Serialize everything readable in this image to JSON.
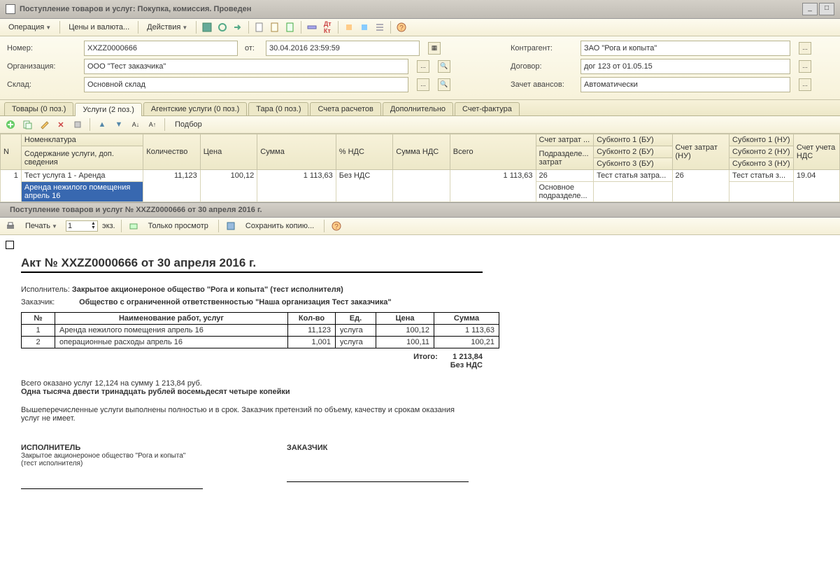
{
  "window": {
    "title": "Поступление товаров и услуг: Покупка, комиссия. Проведен"
  },
  "toolbar": {
    "operation": "Операция",
    "prices": "Цены и валюта...",
    "actions": "Действия"
  },
  "form": {
    "number_label": "Номер:",
    "number_value": "XXZZ0000666",
    "from_label": "от:",
    "date_value": "30.04.2016 23:59:59",
    "org_label": "Организация:",
    "org_value": "ООО \"Тест заказчика\"",
    "storage_label": "Склад:",
    "storage_value": "Основной склад",
    "counterparty_label": "Контрагент:",
    "counterparty_value": "ЗАО \"Рога и копыта\"",
    "contract_label": "Договор:",
    "contract_value": "дог 123 от 01.05.15",
    "advance_label": "Зачет авансов:",
    "advance_value": "Автоматически"
  },
  "tabs": {
    "goods": "Товары (0 поз.)",
    "services": "Услуги (2 поз.)",
    "agent": "Агентские услуги (0 поз.)",
    "tara": "Тара (0 поз.)",
    "accounts": "Счета расчетов",
    "extra": "Дополнительно",
    "invoice": "Счет-фактура"
  },
  "subtoolbar": {
    "selection": "Подбор"
  },
  "grid": {
    "headers": {
      "n": "N",
      "nomen": "Номенклатура",
      "nomen2": "Содержание услуги, доп. сведения",
      "qty": "Количество",
      "price": "Цена",
      "sum": "Сумма",
      "vat_pct": "% НДС",
      "vat_sum": "Сумма НДС",
      "total": "Всего",
      "cost_acc": "Счет затрат ...",
      "cost_acc2": "Подразделе... затрат",
      "sub1": "Субконто 1 (БУ)",
      "sub2": "Субконто 2 (БУ)",
      "sub3": "Субконто 3 (БУ)",
      "cost_nu": "Счет затрат (НУ)",
      "sub1nu": "Субконто 1 (НУ)",
      "sub2nu": "Субконто 2 (НУ)",
      "sub3nu": "Субконто 3 (НУ)",
      "vat_acc": "Счет учета НДС"
    },
    "row": {
      "n": "1",
      "nomen": "Тест услуга 1 - Аренда",
      "desc": "Аренда нежилого помещения апрель 16",
      "qty": "11,123",
      "price": "100,12",
      "sum": "1 113,63",
      "vat": "Без НДС",
      "total": "1 113,63",
      "acc": "26",
      "acc2": "Основное подразделе...",
      "sub1": "Тест статья затра...",
      "nu": "26",
      "sub1nu": "Тест статья з...",
      "vat_acc": "19.04"
    }
  },
  "print": {
    "title": "Поступление товаров и услуг № XXZZ0000666 от 30 апреля 2016 г.",
    "print_btn": "Печать",
    "copies": "1",
    "copies_label": "экз.",
    "view_only": "Только просмотр",
    "save_copy": "Сохранить копию...",
    "doc_title": "Акт № XXZZ0000666 от 30 апреля 2016 г.",
    "performer_label": "Исполнитель:",
    "performer": "Закрытое акционероное общество \"Рога и копыта\" (тест исполнителя)",
    "customer_label": "Заказчик:",
    "customer": "Общество с ограниченной ответственностью \"Наша организация Тест заказчика\"",
    "th_n": "№",
    "th_name": "Наименование работ, услуг",
    "th_qty": "Кол-во",
    "th_unit": "Ед.",
    "th_price": "Цена",
    "th_sum": "Сумма",
    "r1": {
      "n": "1",
      "name": "Аренда нежилого помещения апрель 16",
      "qty": "11,123",
      "unit": "услуга",
      "price": "100,12",
      "sum": "1 113,63"
    },
    "r2": {
      "n": "2",
      "name": "операционные расходы  апрель 16",
      "qty": "1,001",
      "unit": "услуга",
      "price": "100,11",
      "sum": "100,21"
    },
    "total_label": "Итого:",
    "total": "1 213,84",
    "no_vat": "Без НДС",
    "summary": "Всего оказано услуг 12,124 на сумму 1 213,84 руб.",
    "words": "Одна тысяча двести тринадцать рублей восемьдесят четыре копейки",
    "note": "Вышеперечисленные услуги выполнены полностью и в срок. Заказчик претензий по объему, качеству и срокам оказания услуг не имеет.",
    "sig1": "ИСПОЛНИТЕЛЬ",
    "sig1_sub": "Закрытое акционероное общество \"Рога и копыта\" (тест исполнителя)",
    "sig2": "ЗАКАЗЧИК"
  }
}
